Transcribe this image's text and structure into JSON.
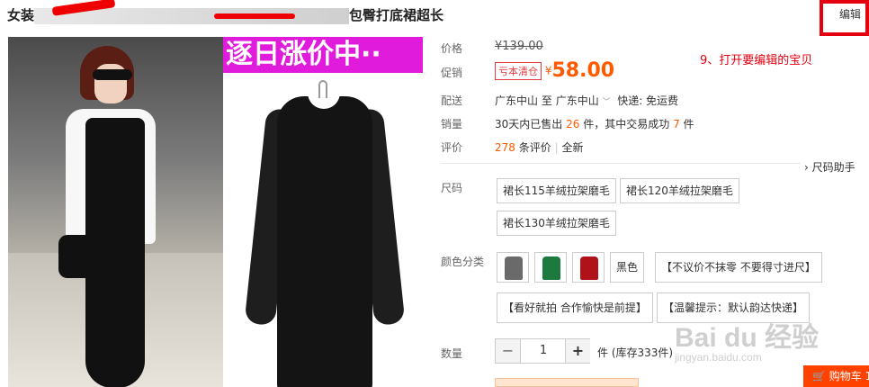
{
  "title": {
    "prefix": "女装",
    "suffix": "包臀打底裙超长"
  },
  "edit_button": "编辑",
  "banner": "逐日涨价中··",
  "annotation": "9、打开要编辑的宝贝",
  "price": {
    "label": "价格",
    "currency": "¥",
    "original": "139.00"
  },
  "promo": {
    "label": "促销",
    "tag": "亏本清仓",
    "currency": "¥",
    "price": "58.00"
  },
  "delivery": {
    "label": "配送",
    "from": "广东中山",
    "to_word": "至",
    "to": "广东中山",
    "shipping": "快递: 免运费"
  },
  "sales": {
    "label": "销量",
    "prefix": "30天内已售出",
    "sold": "26",
    "mid": "件，其中交易成功",
    "success": "7",
    "suffix": "件"
  },
  "reviews": {
    "label": "评价",
    "count": "278",
    "unit": "条评价",
    "sep": "|",
    "all": "全新"
  },
  "size_helper": "尺码助手",
  "size": {
    "label": "尺码",
    "options": [
      "裙长115羊绒拉架磨毛",
      "裙长120羊绒拉架磨毛",
      "裙长130羊绒拉架磨毛"
    ]
  },
  "color": {
    "label": "颜色分类",
    "swatches": [
      "#6a6a6a",
      "#1d7a3e",
      "#b0121a"
    ],
    "options": [
      "黑色",
      "【不议价不抹零 不要得寸进尺】",
      "【看好就拍 合作愉快是前提】",
      "【温馨提示：默认韵达快递】"
    ]
  },
  "quantity": {
    "label": "数量",
    "minus": "−",
    "value": "1",
    "plus": "+",
    "stock": "件 (库存333件)"
  },
  "cart": "购物车 1",
  "watermark": {
    "main": "Bai du 经验",
    "sub": "jingyan.baidu.com"
  }
}
